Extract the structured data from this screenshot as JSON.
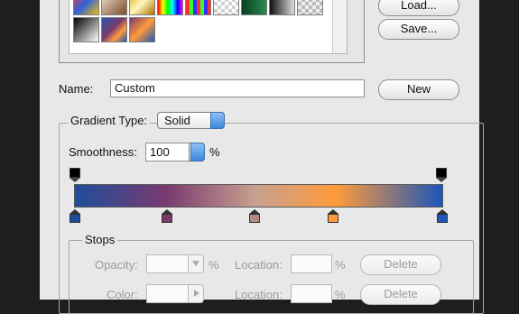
{
  "buttons": {
    "load": "Load...",
    "save": "Save...",
    "new": "New"
  },
  "name_label": "Name:",
  "name_value": "Custom",
  "gradient_type_label": "Gradient Type:",
  "gradient_type_value": "Solid",
  "smoothness_label": "Smoothness:",
  "smoothness_value": "100",
  "percent": "%",
  "stops": {
    "title": "Stops",
    "opacity_label": "Opacity:",
    "color_label": "Color:",
    "location_label": "Location:",
    "delete_label": "Delete"
  },
  "gradient_colors": [
    "#1f4d9c",
    "#7a3a6e",
    "#c7a090",
    "#ff9b3a",
    "#1c56b8"
  ],
  "color_stop_colors": [
    "#1f4d9c",
    "#7a3a6e",
    "#b28a80",
    "#ff9b3a",
    "#1c56b8"
  ]
}
